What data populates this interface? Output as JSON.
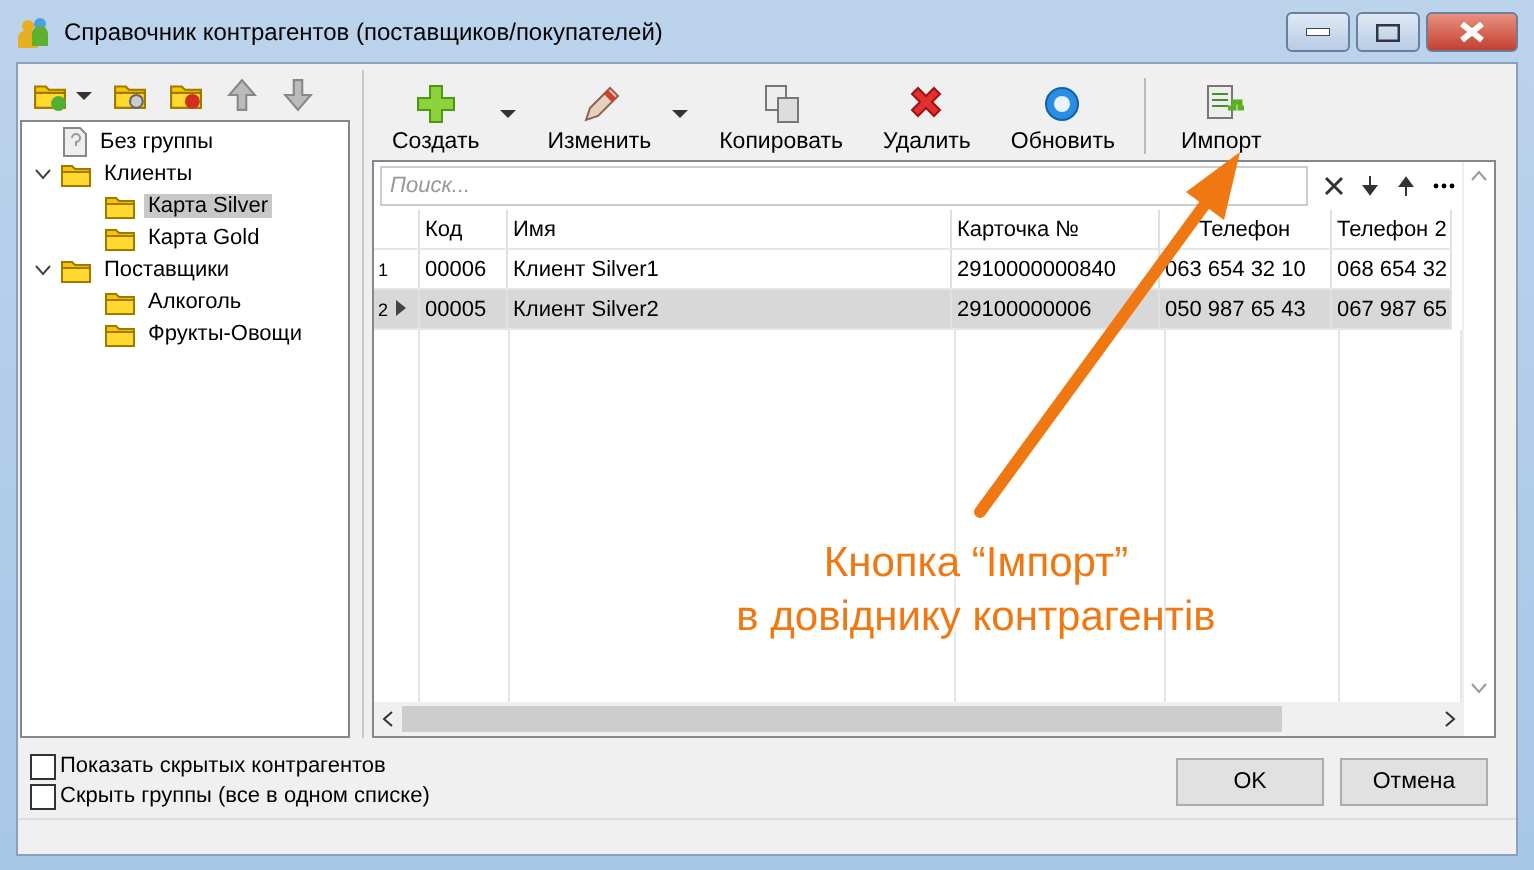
{
  "window": {
    "title": "Справочник контрагентов (поставщиков/покупателей)"
  },
  "group_toolbar": [
    {
      "kind": "folder-add",
      "dropdown": true
    },
    {
      "kind": "folder-settings",
      "dropdown": false
    },
    {
      "kind": "folder-delete",
      "dropdown": false
    },
    {
      "kind": "up",
      "dropdown": false
    },
    {
      "kind": "down",
      "dropdown": false
    }
  ],
  "tree": [
    {
      "label": "Без группы",
      "kind": "page",
      "selected": false
    },
    {
      "label": "Клиенты",
      "kind": "folder",
      "selected": false,
      "expanded": true,
      "children": [
        {
          "label": "Карта Silver",
          "kind": "folder",
          "selected": true
        },
        {
          "label": "Карта Gold",
          "kind": "folder",
          "selected": false
        }
      ]
    },
    {
      "label": "Поставщики",
      "kind": "folder",
      "selected": false,
      "expanded": true,
      "children": [
        {
          "label": "Алкоголь",
          "kind": "folder",
          "selected": false
        },
        {
          "label": "Фрукты-Овощи",
          "kind": "folder",
          "selected": false
        }
      ]
    }
  ],
  "toolbar": [
    {
      "label": "Создать",
      "kind": "add",
      "dropdown": true
    },
    {
      "label": "Изменить",
      "kind": "edit",
      "dropdown": true
    },
    {
      "label": "Копировать",
      "kind": "copy",
      "dropdown": false
    },
    {
      "label": "Удалить",
      "kind": "delete",
      "dropdown": false
    },
    {
      "label": "Обновить",
      "kind": "refresh",
      "dropdown": false
    },
    {
      "label": "Импорт",
      "kind": "import",
      "dropdown": false
    }
  ],
  "search": {
    "placeholder": "Поиск..."
  },
  "table": {
    "columns": [
      "Код",
      "Имя",
      "Карточка №",
      "Телефон",
      "Телефон 2"
    ],
    "rows": [
      {
        "number": "1",
        "selected": false,
        "cells": [
          "00006",
          "Клиент Silver1",
          "2910000000840",
          "063 654 32 10",
          "068 654 32"
        ]
      },
      {
        "number": "2",
        "selected": true,
        "cells": [
          "00005",
          "Клиент Silver2",
          "29100000006",
          "050 987 65 43",
          "067 987 65"
        ]
      }
    ]
  },
  "options": [
    {
      "label": "Показать скрытых контрагентов",
      "checked": false
    },
    {
      "label": "Скрыть группы (все в одном списке)",
      "checked": false
    }
  ],
  "buttons": [
    "OK",
    "Отмена"
  ],
  "annotation": {
    "lines": [
      "Кнопка “Імпорт”",
      "в довіднику контрагентів"
    ]
  }
}
